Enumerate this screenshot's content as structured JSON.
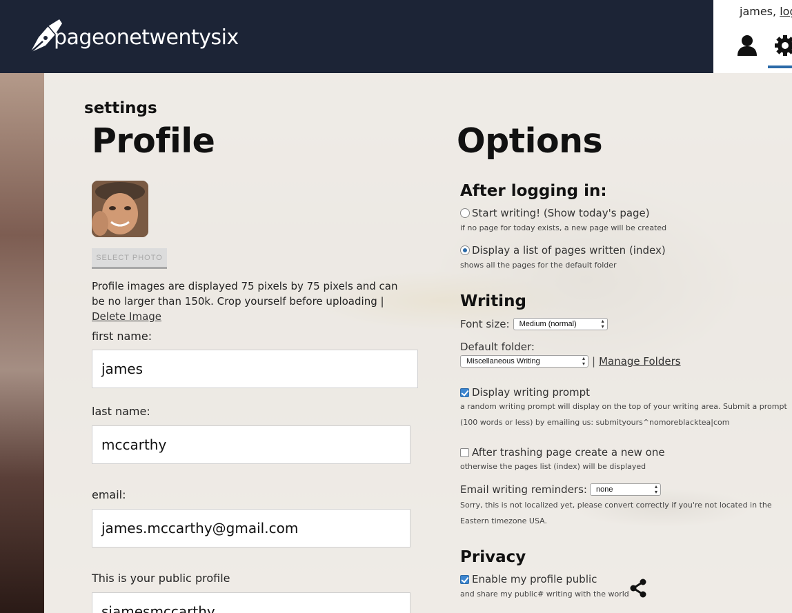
{
  "app": {
    "brand": "pageonetwentysix",
    "user_greeting": "james,",
    "logout_label": "logout"
  },
  "page": {
    "section_title": "settings",
    "profile_heading": "Profile",
    "options_heading": "Options"
  },
  "profile": {
    "select_photo_label": "SELECT PHOTO",
    "photo_note": "Profile images are displayed 75 pixels by 75 pixels and can be no larger than 150k. Crop yourself before uploading |",
    "delete_image_label": "Delete Image",
    "first_name_label": "first name:",
    "first_name_value": "james",
    "last_name_label": "last name:",
    "last_name_value": "mccarthy",
    "email_label": "email:",
    "email_value": "james.mccarthy@gmail.com",
    "public_profile_label": "This is your public profile",
    "public_profile_value": "sjamesmccarthy"
  },
  "options": {
    "after_login_heading": "After logging in:",
    "start_writing_label": "Start writing! (Show today's page)",
    "start_writing_help": "if no page for today exists, a new page will be created",
    "display_list_label": "Display a list of pages written (index)",
    "display_list_help": "shows all the pages for the default folder",
    "writing_heading": "Writing",
    "font_size_label": "Font size:",
    "font_size_value": "Medium (normal)",
    "default_folder_label": "Default folder:",
    "default_folder_value": "Miscellaneous Writing",
    "separator": "|",
    "manage_folders_label": "Manage Folders",
    "prompt_label": "Display writing prompt",
    "prompt_help_1": "a random writing prompt will display on the top of your writing area. Submit a prompt",
    "prompt_help_2": "(100 words or less) by emailing us: submityours^nomoreblacktea|com",
    "trash_label": "After trashing page create a new one",
    "trash_help": "otherwise the pages list (index) will be displayed",
    "reminders_label": "Email writing reminders:",
    "reminders_value": "none",
    "reminders_help_1": "Sorry, this is not localized yet, please convert correctly if you're not located in the",
    "reminders_help_2": "Eastern timezone USA.",
    "privacy_heading": "Privacy",
    "public_label": "Enable my profile public",
    "public_help": "and share my public# writing with the world"
  },
  "state": {
    "after_login_choice": "display_list",
    "prompt_checked": true,
    "trash_checked": false,
    "public_checked": true
  },
  "colors": {
    "header_bg": "#1c2436",
    "accent": "#2b6aa8"
  },
  "icons": [
    "pen-nib-logo-icon",
    "user-icon",
    "gear-icon",
    "share-icon"
  ]
}
